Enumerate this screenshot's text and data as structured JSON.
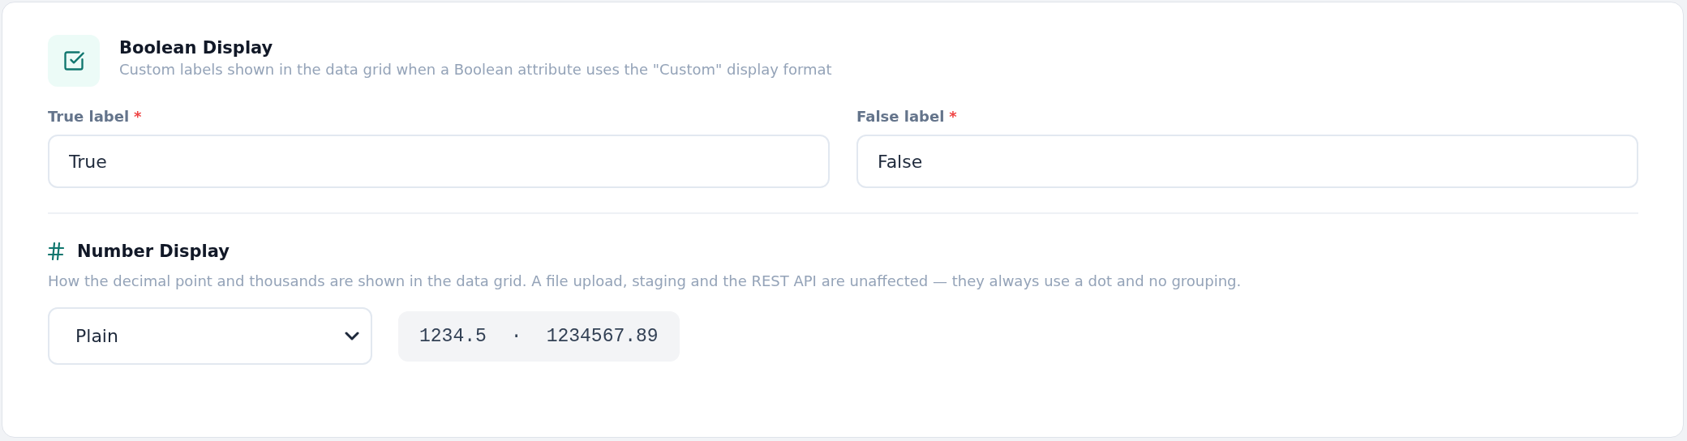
{
  "boolean_section": {
    "title": "Boolean Display",
    "description": "Custom labels shown in the data grid when a Boolean attribute uses the \"Custom\" display format",
    "fields": [
      {
        "label": "True label",
        "required_mark": "*",
        "value": "True"
      },
      {
        "label": "False label",
        "required_mark": "*",
        "value": "False"
      }
    ]
  },
  "number_section": {
    "title": "Number Display",
    "description": "How the decimal point and thousands are shown in the data grid. A file upload, staging and the REST API are unaffected — they always use a dot and no grouping.",
    "select": {
      "value": "Plain"
    },
    "preview": {
      "small_example": "1234.5",
      "separator": "·",
      "large_example": "1234567.89"
    }
  }
}
